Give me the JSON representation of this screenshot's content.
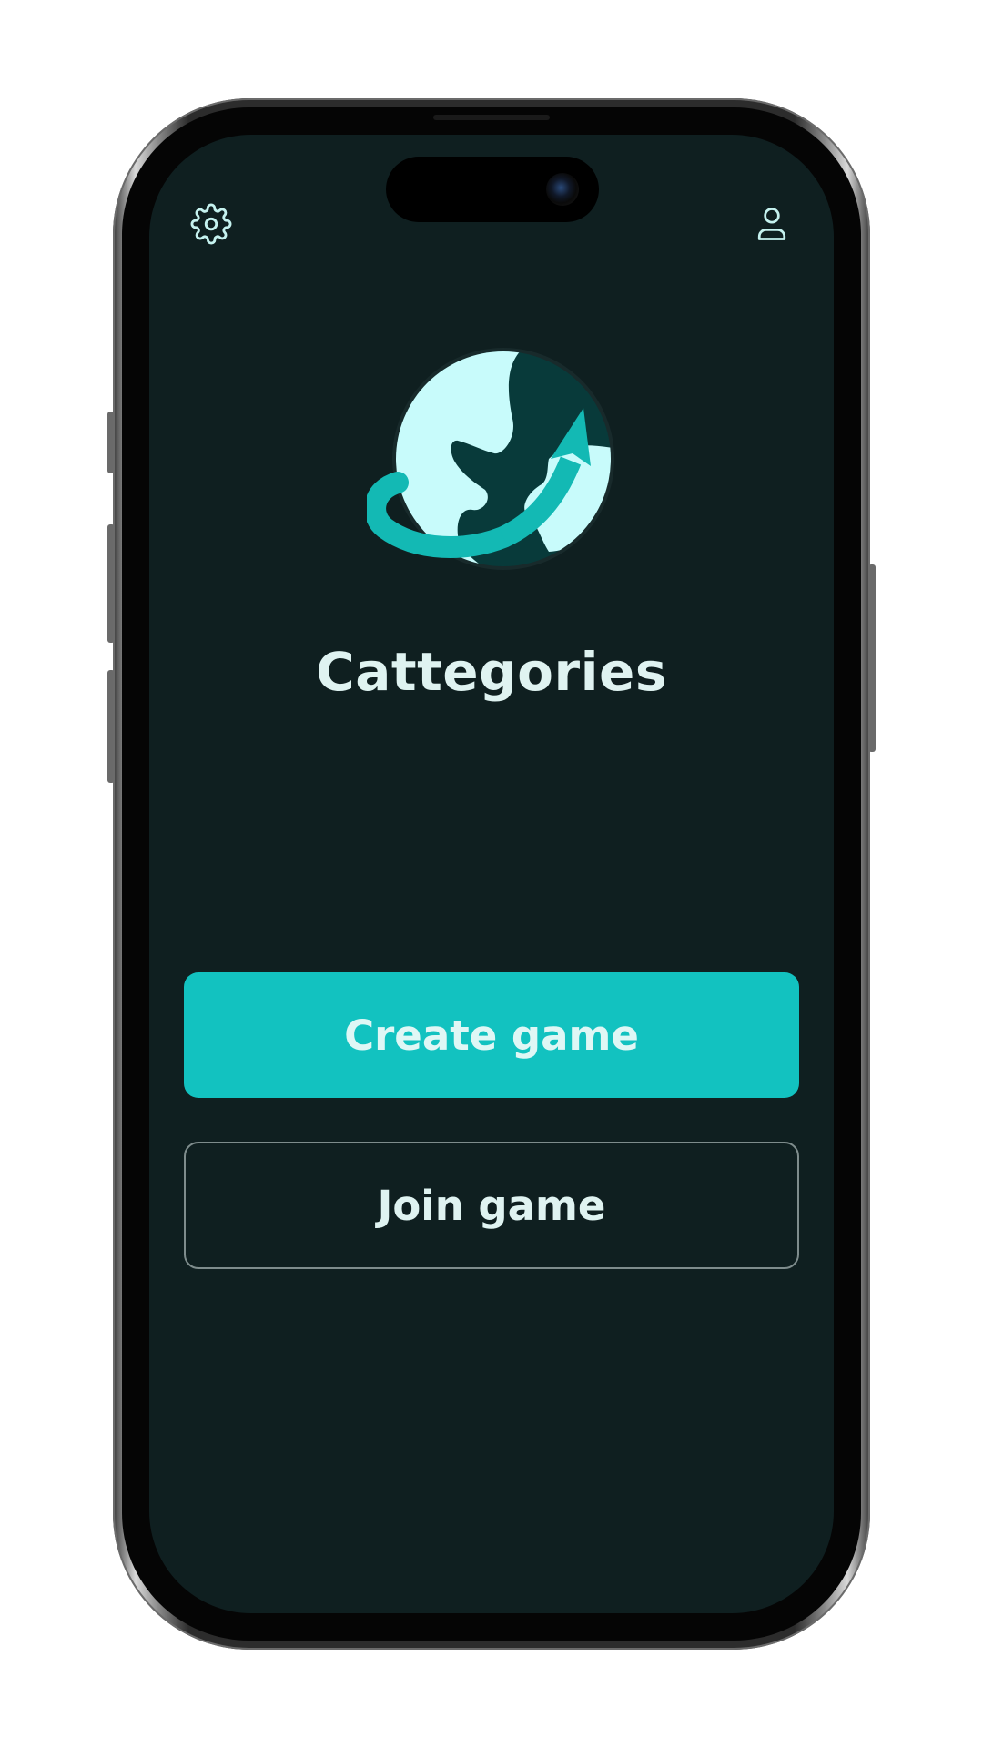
{
  "app": {
    "title": "Cattegories"
  },
  "header": {
    "settings_icon": "gear-icon",
    "profile_icon": "user-icon"
  },
  "actions": {
    "create_label": "Create game",
    "join_label": "Join game"
  },
  "colors": {
    "screen_background": "#0f1f20",
    "accent": "#12c2c0",
    "title_text": "#dff3f1",
    "globe_land": "#c8fbfb",
    "globe_ocean": "#083a3a",
    "outline_border": "#7e8c8c"
  }
}
